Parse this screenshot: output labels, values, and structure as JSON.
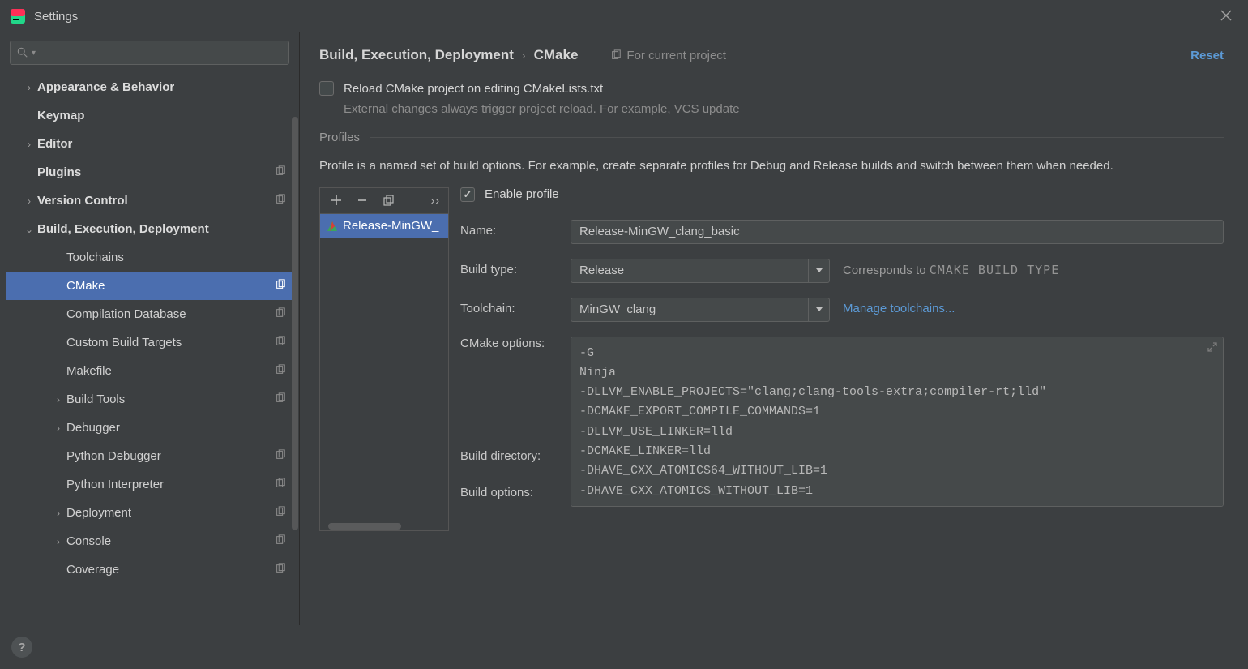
{
  "window": {
    "title": "Settings"
  },
  "actions": {
    "reset": "Reset"
  },
  "search": {
    "placeholder": ""
  },
  "sidebar": {
    "items": [
      {
        "label": "Appearance & Behavior",
        "bold": true,
        "depth": 0,
        "expandable": true,
        "expanded": false,
        "cfg": false
      },
      {
        "label": "Keymap",
        "bold": true,
        "depth": 0,
        "expandable": false,
        "cfg": false
      },
      {
        "label": "Editor",
        "bold": true,
        "depth": 0,
        "expandable": true,
        "expanded": false,
        "cfg": false
      },
      {
        "label": "Plugins",
        "bold": true,
        "depth": 0,
        "expandable": false,
        "cfg": true
      },
      {
        "label": "Version Control",
        "bold": true,
        "depth": 0,
        "expandable": true,
        "expanded": false,
        "cfg": true
      },
      {
        "label": "Build, Execution, Deployment",
        "bold": true,
        "depth": 0,
        "expandable": true,
        "expanded": true,
        "cfg": false
      },
      {
        "label": "Toolchains",
        "bold": false,
        "depth": 1,
        "expandable": false,
        "cfg": false
      },
      {
        "label": "CMake",
        "bold": false,
        "depth": 1,
        "expandable": false,
        "cfg": true,
        "selected": true
      },
      {
        "label": "Compilation Database",
        "bold": false,
        "depth": 1,
        "expandable": false,
        "cfg": true
      },
      {
        "label": "Custom Build Targets",
        "bold": false,
        "depth": 1,
        "expandable": false,
        "cfg": true
      },
      {
        "label": "Makefile",
        "bold": false,
        "depth": 1,
        "expandable": false,
        "cfg": true
      },
      {
        "label": "Build Tools",
        "bold": false,
        "depth": 1,
        "expandable": true,
        "expanded": false,
        "cfg": true
      },
      {
        "label": "Debugger",
        "bold": false,
        "depth": 1,
        "expandable": true,
        "expanded": false,
        "cfg": false
      },
      {
        "label": "Python Debugger",
        "bold": false,
        "depth": 1,
        "expandable": false,
        "cfg": true
      },
      {
        "label": "Python Interpreter",
        "bold": false,
        "depth": 1,
        "expandable": false,
        "cfg": true
      },
      {
        "label": "Deployment",
        "bold": false,
        "depth": 1,
        "expandable": true,
        "expanded": false,
        "cfg": true
      },
      {
        "label": "Console",
        "bold": false,
        "depth": 1,
        "expandable": true,
        "expanded": false,
        "cfg": true
      },
      {
        "label": "Coverage",
        "bold": false,
        "depth": 1,
        "expandable": false,
        "cfg": true
      }
    ]
  },
  "breadcrumb": {
    "parent": "Build, Execution, Deployment",
    "current": "CMake",
    "scope": "For current project"
  },
  "reload": {
    "label": "Reload CMake project on editing CMakeLists.txt",
    "hint": "External changes always trigger project reload. For example, VCS update",
    "checked": false
  },
  "profiles": {
    "section_title": "Profiles",
    "description": "Profile is a named set of build options. For example, create separate profiles for Debug and Release builds and switch between them when needed.",
    "items": [
      {
        "label": "Release-MinGW_"
      }
    ],
    "enable": {
      "label": "Enable profile",
      "checked": true
    }
  },
  "form": {
    "name": {
      "label": "Name:",
      "value": "Release-MinGW_clang_basic"
    },
    "build_type": {
      "label": "Build type:",
      "value": "Release",
      "hint_prefix": "Corresponds to ",
      "hint_mono": "CMAKE_BUILD_TYPE"
    },
    "toolchain": {
      "label": "Toolchain:",
      "value": "MinGW_clang",
      "manage": "Manage toolchains..."
    },
    "cmake_options": {
      "label": "CMake options:",
      "value": "-G\nNinja\n-DLLVM_ENABLE_PROJECTS=\"clang;clang-tools-extra;compiler-rt;lld\"\n-DCMAKE_EXPORT_COMPILE_COMMANDS=1\n-DLLVM_USE_LINKER=lld\n-DCMAKE_LINKER=lld\n-DHAVE_CXX_ATOMICS64_WITHOUT_LIB=1\n-DHAVE_CXX_ATOMICS_WITHOUT_LIB=1"
    },
    "build_directory": {
      "label": "Build directory:"
    },
    "build_options": {
      "label": "Build options:"
    }
  }
}
